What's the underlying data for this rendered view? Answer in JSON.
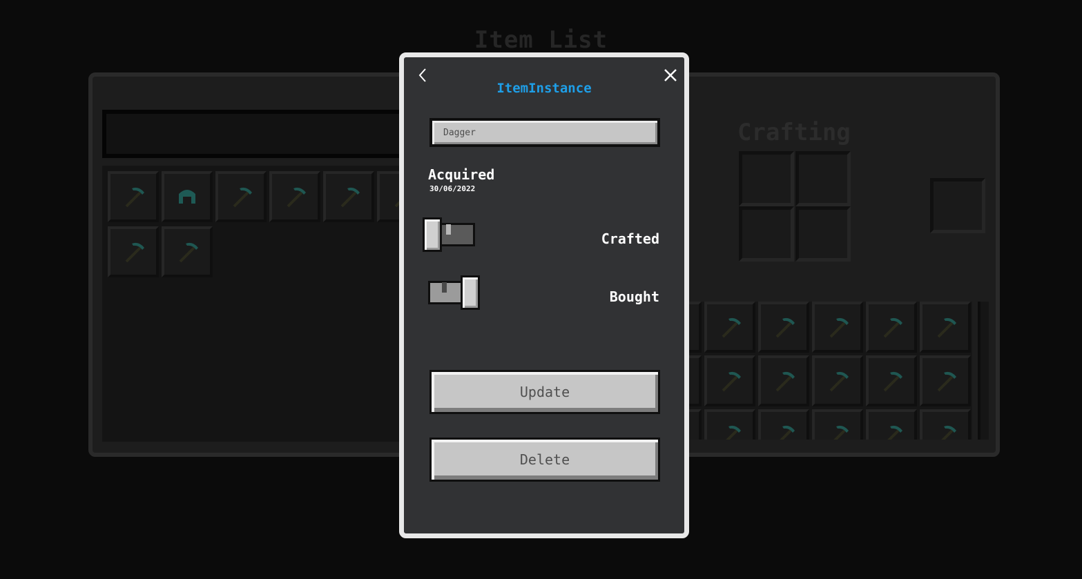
{
  "background": {
    "title": "Item List",
    "crafting_label": "Crafting",
    "list_items": [
      {
        "icon": "pickaxe-icon"
      },
      {
        "icon": "helmet-icon"
      },
      {
        "icon": "pickaxe-icon"
      },
      {
        "icon": "pickaxe-icon"
      },
      {
        "icon": "pickaxe-icon"
      },
      {
        "icon": "pickaxe-icon"
      },
      {
        "icon": "pickaxe-icon"
      },
      {
        "icon": "pickaxe-icon"
      }
    ]
  },
  "modal": {
    "title": "ItemInstance",
    "back_icon": "chevron-left-icon",
    "close_icon": "close-icon",
    "name_field": {
      "value": "Dagger"
    },
    "acquired": {
      "label": "Acquired",
      "date": "30/06/2022"
    },
    "toggles": [
      {
        "label": "Crafted",
        "on": false
      },
      {
        "label": "Bought",
        "on": true
      }
    ],
    "update_label": "Update",
    "delete_label": "Delete"
  },
  "colors": {
    "accent": "#1e9fe8",
    "modal_bg": "#313234",
    "button_bg": "#c6c6c6"
  }
}
